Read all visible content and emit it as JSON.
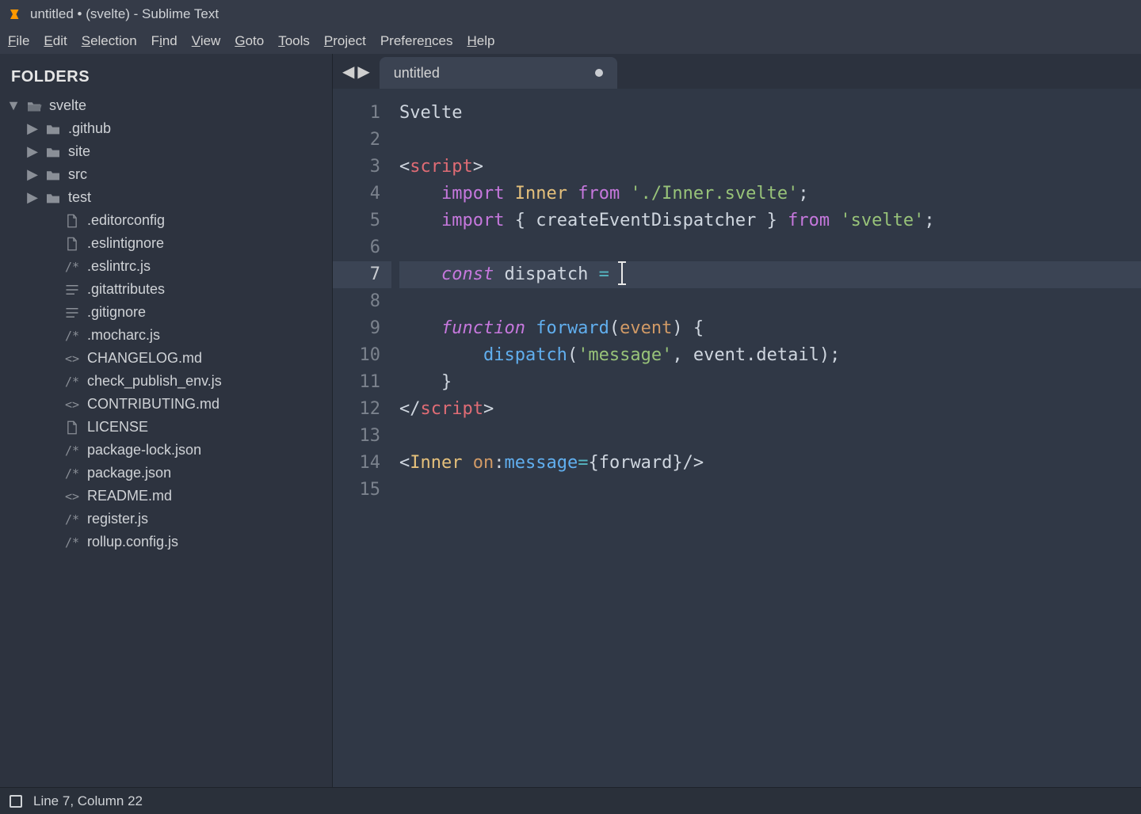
{
  "window": {
    "title": "untitled • (svelte) - Sublime Text"
  },
  "menubar": [
    {
      "label": "File",
      "key": "F"
    },
    {
      "label": "Edit",
      "key": "E"
    },
    {
      "label": "Selection",
      "key": "S"
    },
    {
      "label": "Find",
      "key": "i"
    },
    {
      "label": "View",
      "key": "V"
    },
    {
      "label": "Goto",
      "key": "G"
    },
    {
      "label": "Tools",
      "key": "T"
    },
    {
      "label": "Project",
      "key": "P"
    },
    {
      "label": "Preferences",
      "key": "n"
    },
    {
      "label": "Help",
      "key": "H"
    }
  ],
  "sidebar": {
    "heading": "FOLDERS",
    "tree": [
      {
        "depth": 0,
        "expand": "open",
        "icon": "folder-open",
        "label": "svelte"
      },
      {
        "depth": 1,
        "expand": "closed",
        "icon": "folder",
        "label": ".github"
      },
      {
        "depth": 1,
        "expand": "closed",
        "icon": "folder",
        "label": "site"
      },
      {
        "depth": 1,
        "expand": "closed",
        "icon": "folder",
        "label": "src"
      },
      {
        "depth": 1,
        "expand": "closed",
        "icon": "folder",
        "label": "test"
      },
      {
        "depth": 2,
        "expand": "none",
        "icon": "file",
        "label": ".editorconfig"
      },
      {
        "depth": 2,
        "expand": "none",
        "icon": "file",
        "label": ".eslintignore"
      },
      {
        "depth": 2,
        "expand": "none",
        "icon": "js",
        "label": ".eslintrc.js"
      },
      {
        "depth": 2,
        "expand": "none",
        "icon": "list",
        "label": ".gitattributes"
      },
      {
        "depth": 2,
        "expand": "none",
        "icon": "list",
        "label": ".gitignore"
      },
      {
        "depth": 2,
        "expand": "none",
        "icon": "js",
        "label": ".mocharc.js"
      },
      {
        "depth": 2,
        "expand": "none",
        "icon": "code",
        "label": "CHANGELOG.md"
      },
      {
        "depth": 2,
        "expand": "none",
        "icon": "js",
        "label": "check_publish_env.js"
      },
      {
        "depth": 2,
        "expand": "none",
        "icon": "code",
        "label": "CONTRIBUTING.md"
      },
      {
        "depth": 2,
        "expand": "none",
        "icon": "file",
        "label": "LICENSE"
      },
      {
        "depth": 2,
        "expand": "none",
        "icon": "js",
        "label": "package-lock.json"
      },
      {
        "depth": 2,
        "expand": "none",
        "icon": "js",
        "label": "package.json"
      },
      {
        "depth": 2,
        "expand": "none",
        "icon": "code",
        "label": "README.md"
      },
      {
        "depth": 2,
        "expand": "none",
        "icon": "js",
        "label": "register.js"
      },
      {
        "depth": 2,
        "expand": "none",
        "icon": "js",
        "label": "rollup.config.js"
      }
    ]
  },
  "tabs": {
    "active": {
      "label": "untitled",
      "dirty": true
    }
  },
  "editor": {
    "active_line": 7,
    "lines": [
      {
        "n": 1,
        "tokens": [
          [
            "ident",
            "Svelte"
          ]
        ]
      },
      {
        "n": 2,
        "tokens": []
      },
      {
        "n": 3,
        "tokens": [
          [
            "punc",
            "<"
          ],
          [
            "tag",
            "script"
          ],
          [
            "punc",
            ">"
          ]
        ]
      },
      {
        "n": 4,
        "tokens": [
          [
            "ident",
            "    "
          ],
          [
            "keyword-plain",
            "import"
          ],
          [
            "ident",
            " "
          ],
          [
            "type",
            "Inner"
          ],
          [
            "ident",
            " "
          ],
          [
            "keyword-plain",
            "from"
          ],
          [
            "ident",
            " "
          ],
          [
            "string",
            "'./Inner.svelte'"
          ],
          [
            "punc",
            ";"
          ]
        ]
      },
      {
        "n": 5,
        "tokens": [
          [
            "ident",
            "    "
          ],
          [
            "keyword-plain",
            "import"
          ],
          [
            "ident",
            " "
          ],
          [
            "punc",
            "{ "
          ],
          [
            "ident",
            "createEventDispatcher"
          ],
          [
            "punc",
            " }"
          ],
          [
            "ident",
            " "
          ],
          [
            "keyword-plain",
            "from"
          ],
          [
            "ident",
            " "
          ],
          [
            "string",
            "'svelte'"
          ],
          [
            "punc",
            ";"
          ]
        ]
      },
      {
        "n": 6,
        "tokens": []
      },
      {
        "n": 7,
        "tokens": [
          [
            "ident",
            "    "
          ],
          [
            "keyword",
            "const"
          ],
          [
            "ident",
            " dispatch "
          ],
          [
            "op",
            "="
          ],
          [
            "ident",
            " "
          ],
          [
            "cursor",
            ""
          ]
        ]
      },
      {
        "n": 8,
        "tokens": []
      },
      {
        "n": 9,
        "tokens": [
          [
            "ident",
            "    "
          ],
          [
            "keyword",
            "function"
          ],
          [
            "ident",
            " "
          ],
          [
            "func",
            "forward"
          ],
          [
            "punc",
            "("
          ],
          [
            "param",
            "event"
          ],
          [
            "punc",
            ") {"
          ]
        ]
      },
      {
        "n": 10,
        "tokens": [
          [
            "ident",
            "        "
          ],
          [
            "func",
            "dispatch"
          ],
          [
            "punc",
            "("
          ],
          [
            "string",
            "'message'"
          ],
          [
            "punc",
            ", "
          ],
          [
            "ident",
            "event"
          ],
          [
            "punc",
            "."
          ],
          [
            "ident",
            "detail"
          ],
          [
            "punc",
            ");"
          ]
        ]
      },
      {
        "n": 11,
        "tokens": [
          [
            "ident",
            "    "
          ],
          [
            "punc",
            "}"
          ]
        ]
      },
      {
        "n": 12,
        "tokens": [
          [
            "punc",
            "</"
          ],
          [
            "tag",
            "script"
          ],
          [
            "punc",
            ">"
          ]
        ]
      },
      {
        "n": 13,
        "tokens": []
      },
      {
        "n": 14,
        "tokens": [
          [
            "punc",
            "<"
          ],
          [
            "type",
            "Inner"
          ],
          [
            "ident",
            " "
          ],
          [
            "attr",
            "on"
          ],
          [
            "punc",
            ":"
          ],
          [
            "func",
            "message"
          ],
          [
            "op",
            "="
          ],
          [
            "punc",
            "{"
          ],
          [
            "ident",
            "forward"
          ],
          [
            "punc",
            "}/>"
          ]
        ]
      },
      {
        "n": 15,
        "tokens": []
      }
    ]
  },
  "statusbar": {
    "position": "Line 7, Column 22"
  }
}
